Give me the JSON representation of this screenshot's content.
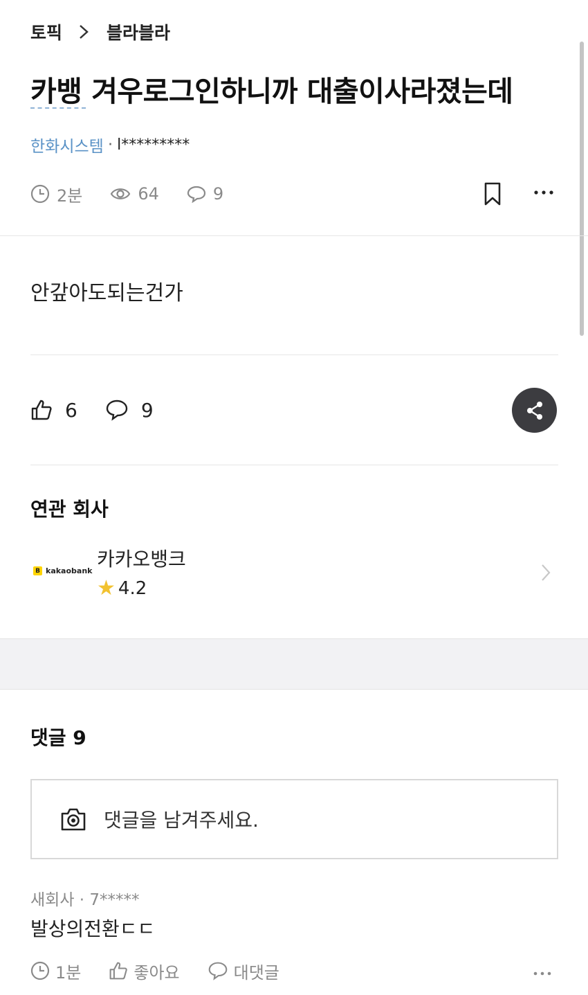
{
  "breadcrumb": {
    "topic": "토픽",
    "board": "블라블라"
  },
  "post": {
    "title": "카뱅 겨우로그인하니까 대출이사라졌는데",
    "company": "한화시스템",
    "author": "l*********",
    "time": "2분",
    "views": "64",
    "comments": "9",
    "body": "안갚아도되는건가",
    "likes": "6",
    "comment_count": "9"
  },
  "related": {
    "title": "연관 회사",
    "company_name": "카카오뱅크",
    "logo_text": "kakaobank",
    "logo_letter": "B",
    "rating": "4.2"
  },
  "comments_section": {
    "title": "댓글 9",
    "placeholder": "댓글을 남겨주세요."
  },
  "comment": {
    "meta": "새회사 · 7*****",
    "text": "발상의전환ㄷㄷ",
    "time": "1분",
    "like_label": "좋아요",
    "reply_label": "대댓글"
  },
  "colors": {
    "company_link": "#5a92c6",
    "star": "#f2c230",
    "share_bg": "#3c3c40"
  }
}
